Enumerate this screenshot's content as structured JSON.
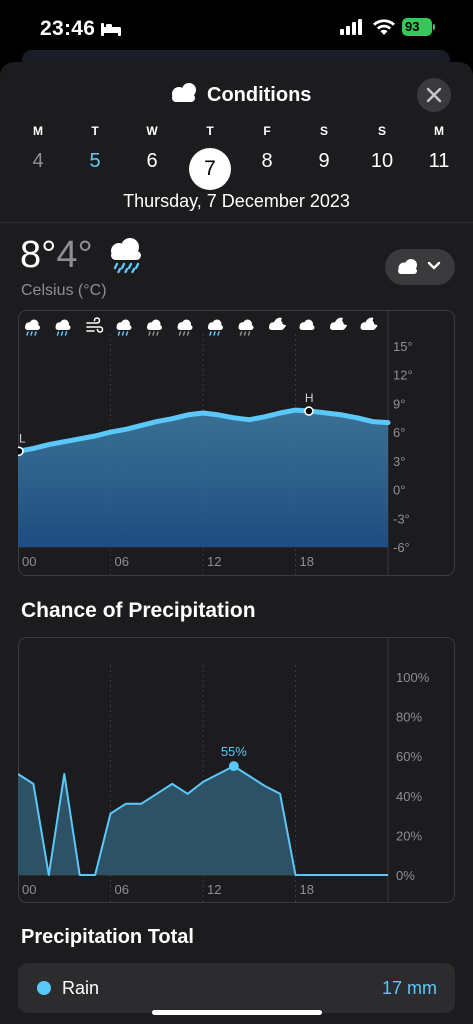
{
  "status_bar": {
    "time": "23:46",
    "battery": "93"
  },
  "header": {
    "title": "Conditions"
  },
  "days": [
    {
      "letter": "M",
      "num": "4",
      "state": "past"
    },
    {
      "letter": "T",
      "num": "5",
      "state": "today"
    },
    {
      "letter": "W",
      "num": "6",
      "state": "future"
    },
    {
      "letter": "T",
      "num": "7",
      "state": "selected"
    },
    {
      "letter": "F",
      "num": "8",
      "state": "future"
    },
    {
      "letter": "S",
      "num": "9",
      "state": "future"
    },
    {
      "letter": "S",
      "num": "10",
      "state": "future"
    },
    {
      "letter": "M",
      "num": "11",
      "state": "future"
    }
  ],
  "full_date": "Thursday, 7 December 2023",
  "temperature": {
    "high": "8°",
    "low": "4°",
    "units": "Celsius (°C)"
  },
  "chart_data": [
    {
      "type": "area",
      "x_ticks": [
        "00",
        "06",
        "12",
        "18"
      ],
      "y_ticks": [
        "15°",
        "12°",
        "9°",
        "6°",
        "3°",
        "0°",
        "-3°",
        "-6°"
      ],
      "ylim": [
        -6,
        15
      ],
      "x": [
        0,
        1,
        2,
        3,
        4,
        5,
        6,
        7,
        8,
        9,
        10,
        11,
        12,
        13,
        14,
        15,
        16,
        17,
        18,
        19,
        20,
        21,
        22,
        23,
        24
      ],
      "values": [
        4,
        4.3,
        4.7,
        5,
        5.3,
        5.6,
        6,
        6.3,
        6.7,
        7.1,
        7.4,
        7.8,
        8,
        7.8,
        7.5,
        7.3,
        7.6,
        8,
        8.3,
        8.2,
        8,
        7.8,
        7.5,
        7.1,
        7
      ],
      "low_label": "L",
      "high_label": "H",
      "low_x": 0,
      "high_x": 19,
      "hour_icons": [
        "rain",
        "rain",
        "wind",
        "rain",
        "drizzle",
        "drizzle",
        "rain",
        "drizzle",
        "partly-cloudy-night",
        "cloud",
        "partly-cloudy-night",
        "partly-cloudy-night"
      ],
      "color": "#5ac8fa"
    },
    {
      "type": "area",
      "title": "Chance of Precipitation",
      "x_ticks": [
        "00",
        "06",
        "12",
        "18"
      ],
      "y_ticks": [
        "100%",
        "80%",
        "60%",
        "40%",
        "20%",
        "0%"
      ],
      "ylim": [
        0,
        100
      ],
      "points": [
        [
          0,
          51
        ],
        [
          1,
          46
        ],
        [
          2,
          0
        ],
        [
          3,
          51
        ],
        [
          4,
          0
        ],
        [
          5,
          0
        ],
        [
          6,
          31
        ],
        [
          7,
          36
        ],
        [
          8,
          36
        ],
        [
          9,
          41
        ],
        [
          10,
          46
        ],
        [
          11,
          41
        ],
        [
          12,
          47
        ],
        [
          13,
          51
        ],
        [
          14,
          55
        ],
        [
          15,
          50
        ],
        [
          16,
          45
        ],
        [
          17,
          41
        ],
        [
          18,
          0
        ],
        [
          19,
          0
        ],
        [
          20,
          0
        ],
        [
          21,
          0
        ],
        [
          22,
          0
        ],
        [
          23,
          0
        ],
        [
          24,
          0
        ]
      ],
      "peak_label": "55%",
      "peak_x": 14,
      "peak_value": 55,
      "color": "#5ac8fa"
    }
  ],
  "precip_title": "Chance of Precipitation",
  "total_title": "Precipitation Total",
  "rain": {
    "label": "Rain",
    "value": "17 mm"
  }
}
